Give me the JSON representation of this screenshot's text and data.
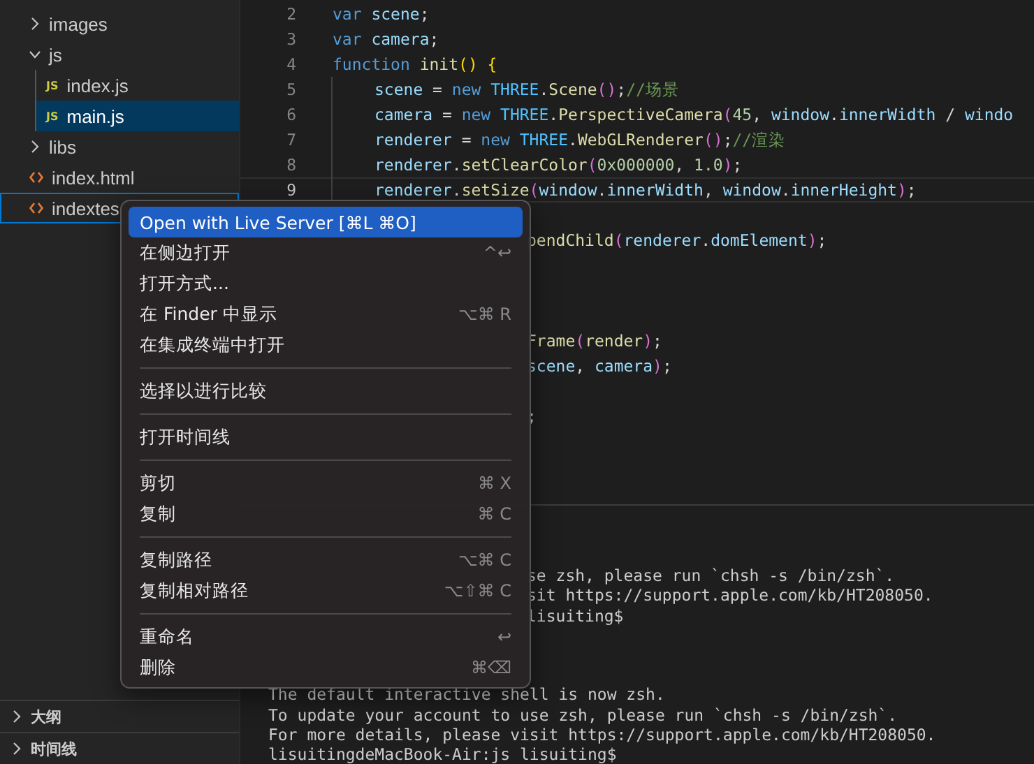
{
  "explorer": {
    "items": [
      {
        "label": "images",
        "kind": "folder",
        "expanded": false,
        "selected": false,
        "focused": false
      },
      {
        "label": "js",
        "kind": "folder",
        "expanded": true,
        "selected": false,
        "focused": false,
        "children": [
          {
            "label": "index.js",
            "kind": "js",
            "badge": "JS",
            "selected": false,
            "focused": false
          },
          {
            "label": "main.js",
            "kind": "js",
            "badge": "JS",
            "selected": true,
            "focused": false
          }
        ]
      },
      {
        "label": "libs",
        "kind": "folder",
        "expanded": false,
        "selected": false,
        "focused": false
      },
      {
        "label": "index.html",
        "kind": "html",
        "selected": false,
        "focused": false
      },
      {
        "label": "indextes",
        "kind": "html",
        "selected": false,
        "focused": true
      }
    ],
    "sections": [
      {
        "label": "大纲",
        "expanded": false
      },
      {
        "label": "时间线",
        "expanded": false
      }
    ]
  },
  "code_lines": [
    {
      "kind": "full",
      "number": "2",
      "current": false,
      "tokens": [
        {
          "t": "var",
          "kind": "kw"
        },
        {
          "t": " scene",
          "kind": "var"
        },
        {
          "t": ";",
          "kind": "p"
        }
      ]
    },
    {
      "kind": "full",
      "number": "3",
      "current": false,
      "tokens": [
        {
          "t": "var",
          "kind": "kw"
        },
        {
          "t": " camera",
          "kind": "var"
        },
        {
          "t": ";",
          "kind": "p"
        }
      ]
    },
    {
      "kind": "full",
      "number": "4",
      "current": false,
      "tokens": [
        {
          "t": "function",
          "kind": "kw"
        },
        {
          "t": " init",
          "kind": "fn"
        },
        {
          "t": "()",
          "kind": "b1"
        },
        {
          "t": " {",
          "kind": "b1"
        }
      ],
      "children": [
        {
          "kind": "full",
          "number": "5",
          "current": false,
          "tokens": [
            {
              "t": "scene",
              "kind": "var"
            },
            {
              "t": " = ",
              "kind": "p"
            },
            {
              "t": "new",
              "kind": "kw"
            },
            {
              "t": " THREE",
              "kind": "cls"
            },
            {
              "t": ".",
              "kind": "p"
            },
            {
              "t": "Scene",
              "kind": "fn"
            },
            {
              "t": "()",
              "kind": "b2"
            },
            {
              "t": ";",
              "kind": "p"
            },
            {
              "t": "//场景",
              "kind": "cm"
            }
          ]
        },
        {
          "kind": "full",
          "number": "6",
          "current": false,
          "tokens": [
            {
              "t": "camera",
              "kind": "var"
            },
            {
              "t": " = ",
              "kind": "p"
            },
            {
              "t": "new",
              "kind": "kw"
            },
            {
              "t": " THREE",
              "kind": "cls"
            },
            {
              "t": ".",
              "kind": "p"
            },
            {
              "t": "PerspectiveCamera",
              "kind": "fn"
            },
            {
              "t": "(",
              "kind": "b2"
            },
            {
              "t": "45",
              "kind": "num"
            },
            {
              "t": ", ",
              "kind": "p"
            },
            {
              "t": "window",
              "kind": "var"
            },
            {
              "t": ".",
              "kind": "p"
            },
            {
              "t": "innerWidth",
              "kind": "var"
            },
            {
              "t": " / ",
              "kind": "p"
            },
            {
              "t": "windo",
              "kind": "var"
            }
          ]
        },
        {
          "kind": "full",
          "number": "7",
          "current": false,
          "tokens": [
            {
              "t": "renderer",
              "kind": "var"
            },
            {
              "t": " = ",
              "kind": "p"
            },
            {
              "t": "new",
              "kind": "kw"
            },
            {
              "t": " THREE",
              "kind": "cls"
            },
            {
              "t": ".",
              "kind": "p"
            },
            {
              "t": "WebGLRenderer",
              "kind": "fn"
            },
            {
              "t": "()",
              "kind": "b2"
            },
            {
              "t": ";",
              "kind": "p"
            },
            {
              "t": "//渲染",
              "kind": "cm"
            }
          ]
        },
        {
          "kind": "full",
          "number": "8",
          "current": false,
          "tokens": [
            {
              "t": "renderer",
              "kind": "var"
            },
            {
              "t": ".",
              "kind": "p"
            },
            {
              "t": "setClearColor",
              "kind": "fn"
            },
            {
              "t": "(",
              "kind": "b2"
            },
            {
              "t": "0x000000",
              "kind": "num"
            },
            {
              "t": ", ",
              "kind": "p"
            },
            {
              "t": "1.0",
              "kind": "num"
            },
            {
              "t": ")",
              "kind": "b2"
            },
            {
              "t": ";",
              "kind": "p"
            }
          ]
        },
        {
          "kind": "full",
          "number": "9",
          "current": true,
          "tokens": [
            {
              "t": "renderer",
              "kind": "var"
            },
            {
              "t": ".",
              "kind": "p"
            },
            {
              "t": "setSize",
              "kind": "fn"
            },
            {
              "t": "(",
              "kind": "b2"
            },
            {
              "t": "window",
              "kind": "var"
            },
            {
              "t": ".",
              "kind": "p"
            },
            {
              "t": "innerWidth",
              "kind": "var"
            },
            {
              "t": ", ",
              "kind": "p"
            },
            {
              "t": "window",
              "kind": "var"
            },
            {
              "t": ".",
              "kind": "p"
            },
            {
              "t": "innerHeight",
              "kind": "var"
            },
            {
              "t": ")",
              "kind": "b2"
            },
            {
              "t": ";",
              "kind": "p"
            }
          ]
        }
      ]
    },
    {
      "kind": "blank"
    },
    {
      "kind": "partial",
      "tokens": [
        {
          "t": "pendChild",
          "kind": "fn"
        },
        {
          "t": "(",
          "kind": "b2"
        },
        {
          "t": "renderer",
          "kind": "var"
        },
        {
          "t": ".",
          "kind": "p"
        },
        {
          "t": "domElement",
          "kind": "var"
        },
        {
          "t": ")",
          "kind": "b2"
        },
        {
          "t": ";",
          "kind": "p"
        }
      ]
    },
    {
      "kind": "blank"
    },
    {
      "kind": "blank"
    },
    {
      "kind": "blank"
    },
    {
      "kind": "partial",
      "tokens": [
        {
          "t": "Frame",
          "kind": "fn"
        },
        {
          "t": "(",
          "kind": "b2"
        },
        {
          "t": "render",
          "kind": "fn"
        },
        {
          "t": ")",
          "kind": "b2"
        },
        {
          "t": ";",
          "kind": "p"
        }
      ]
    },
    {
      "kind": "partial",
      "tokens": [
        {
          "t": "scene",
          "kind": "var"
        },
        {
          "t": ", ",
          "kind": "p"
        },
        {
          "t": "camera",
          "kind": "var"
        },
        {
          "t": ")",
          "kind": "b2"
        },
        {
          "t": ";",
          "kind": "p"
        }
      ]
    },
    {
      "kind": "blank"
    },
    {
      "kind": "partial",
      "tokens": [
        {
          "t": ";",
          "kind": "p"
        }
      ]
    }
  ],
  "terminal_lines": [
    {
      "kind": "partial",
      "text": "se zsh, please run `chsh -s /bin/zsh`."
    },
    {
      "kind": "partial",
      "text": "sit https://support.apple.com/kb/HT208050."
    },
    {
      "kind": "partial",
      "text": "lisuiting$"
    },
    {
      "kind": "blank"
    },
    {
      "kind": "blank"
    },
    {
      "kind": "blank"
    },
    {
      "kind": "full",
      "text": "The default interactive shell is now zsh."
    },
    {
      "kind": "full",
      "text": "To update your account to use zsh, please run `chsh -s /bin/zsh`."
    },
    {
      "kind": "full",
      "text": "For more details, please visit https://support.apple.com/kb/HT208050."
    },
    {
      "kind": "full",
      "text": "lisuitingdeMacBook-Air:js lisuiting$"
    }
  ],
  "context_menu": [
    {
      "kind": "item",
      "label": "Open with Live Server [⌘L ⌘O]",
      "selected": true
    },
    {
      "kind": "item",
      "label": "在侧边打开",
      "shortcut": "^↩",
      "selected": false
    },
    {
      "kind": "item",
      "label": "打开方式...",
      "selected": false
    },
    {
      "kind": "item",
      "label": "在 Finder 中显示",
      "shortcut": "⌥⌘ R",
      "selected": false
    },
    {
      "kind": "item",
      "label": "在集成终端中打开",
      "selected": false
    },
    {
      "kind": "separator"
    },
    {
      "kind": "item",
      "label": "选择以进行比较",
      "selected": false
    },
    {
      "kind": "separator"
    },
    {
      "kind": "item",
      "label": "打开时间线",
      "selected": false
    },
    {
      "kind": "separator"
    },
    {
      "kind": "item",
      "label": "剪切",
      "shortcut": "⌘ X",
      "selected": false
    },
    {
      "kind": "item",
      "label": "复制",
      "shortcut": "⌘ C",
      "selected": false
    },
    {
      "kind": "separator"
    },
    {
      "kind": "item",
      "label": "复制路径",
      "shortcut": "⌥⌘ C",
      "selected": false
    },
    {
      "kind": "item",
      "label": "复制相对路径",
      "shortcut": "⌥⇧⌘ C",
      "selected": false
    },
    {
      "kind": "separator"
    },
    {
      "kind": "item",
      "label": "重命名",
      "shortcut": "↩",
      "selected": false
    },
    {
      "kind": "item",
      "label": "删除",
      "shortcut": "⌘⌫",
      "selected": false
    }
  ]
}
